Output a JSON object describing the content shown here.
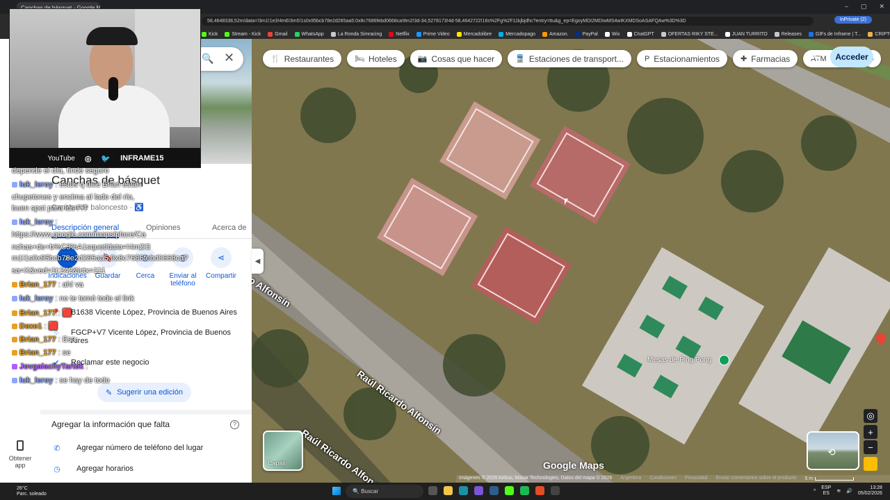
{
  "browser": {
    "tab_title": "Canchas de básquet - Google Maps",
    "url": "58,4648338,52m/data=!3m1!1e3!4m6!3m5!1s0x95bcb78e2d285aa5:0x8c7686febd0668ca!8m2!3d-34,5278173!4d-58,4642722!16s%2Fg%2F11kjbjdhc?entry=ttu&g_ep=EgoyMDI2MDIwMS4wIKXMDSoASAFQAw%3D%3D",
    "inprivate_label": "InPrivate (2)",
    "bookmarks": [
      {
        "label": "Kick",
        "color": "#53fc18"
      },
      {
        "label": "Stream - Kick",
        "color": "#53fc18"
      },
      {
        "label": "Gmail",
        "color": "#ea4335"
      },
      {
        "label": "WhatsApp",
        "color": "#25d366"
      },
      {
        "label": "La Ronda Simracing",
        "color": "#c8c8c8"
      },
      {
        "label": "Netflix",
        "color": "#e50914"
      },
      {
        "label": "Prime Video",
        "color": "#1a98ff"
      },
      {
        "label": "Mercadolibre",
        "color": "#ffe600"
      },
      {
        "label": "Mercadopago",
        "color": "#00b1ea"
      },
      {
        "label": "Amazon.",
        "color": "#ff9900"
      },
      {
        "label": "PayPal",
        "color": "#003087"
      },
      {
        "label": "Wix",
        "color": "#ffffff"
      },
      {
        "label": "ChatGPT",
        "color": "#ffffff"
      },
      {
        "label": "OFERTAS RIKY STE...",
        "color": "#c8c8c8"
      },
      {
        "label": "JUAN TURRITO",
        "color": "#ffffff"
      },
      {
        "label": "Releases",
        "color": "#c8c8c8"
      },
      {
        "label": "GIFs de Inframe | T...",
        "color": "#1a73e8"
      },
      {
        "label": "CRIPTO",
        "color": "#e8b44c"
      },
      {
        "label": "aires",
        "color": "#e8b44c"
      }
    ]
  },
  "map": {
    "chips": [
      {
        "icon": "restaurant-icon",
        "glyph": "🍴",
        "label": "Restaurantes"
      },
      {
        "icon": "hotel-icon",
        "glyph": "🛏",
        "label": "Hoteles"
      },
      {
        "icon": "camera-icon",
        "glyph": "📷",
        "label": "Cosas que hacer"
      },
      {
        "icon": "train-icon",
        "glyph": "🚆",
        "label": "Estaciones de transport..."
      },
      {
        "icon": "parking-icon",
        "glyph": "P",
        "label": "Estacionamientos"
      },
      {
        "icon": "pharmacy-icon",
        "glyph": "✚",
        "label": "Farmacias"
      },
      {
        "icon": "atm-icon",
        "glyph": "ATM",
        "label": "Cajer"
      }
    ],
    "signin": "Acceder",
    "streets": [
      "Raúl Ricardo Alfonsín",
      "Raúl Ricardo Alfonsín",
      "o Alfonsín"
    ],
    "poi": "Mesas de Ping Pong",
    "logo": "Google Maps",
    "attribution": "Imágenes © 2026 Airbus, Maxar Technologies, Datos del mapa © 2026",
    "footer_links": [
      "Argentina",
      "Condiciones",
      "Privacidad",
      "Enviar comentarios sobre el producto"
    ],
    "scale": "5 m",
    "layers_label": "Capas"
  },
  "left_rail": {
    "get_app": "Obtener app"
  },
  "place": {
    "title": "Canchas de básquet",
    "category": "Cancha de baloncesto",
    "tabs": [
      "Descripción general",
      "Opiniones",
      "Acerca de"
    ],
    "actions": [
      {
        "icon": "directions-icon",
        "glyph": "➤",
        "label": "Indicaciones"
      },
      {
        "icon": "bookmark-icon",
        "glyph": "🔖",
        "label": "Guardar"
      },
      {
        "icon": "nearby-icon",
        "glyph": "◎",
        "label": "Cerca"
      },
      {
        "icon": "send-to-phone-icon",
        "glyph": "▯",
        "label": "Enviar al teléfono"
      },
      {
        "icon": "share-icon",
        "glyph": "⋖",
        "label": "Compartir"
      }
    ],
    "address": "B1638 Vicente López, Provincia de Buenos Aires",
    "plus_code": "FGCP+V7 Vicente López, Provincia de Buenos Aires",
    "claim": "Reclamar este negocio",
    "suggest_edit": "Sugerir una edición",
    "missing_title": "Agregar la información que falta",
    "add_phone": "Agregar número de teléfono del lugar",
    "add_hours": "Agregar horarios"
  },
  "webcam": {
    "youtube": "YouTube",
    "handle": "INFRAME15"
  },
  "chat": [
    {
      "user": "",
      "msg": "depende el día, finde seguro",
      "color": "#ffffff"
    },
    {
      "user": "luk_leroy",
      "msg": ": estos q dice Brian están",
      "color": "#8fa6ff"
    },
    {
      "user": "",
      "msg": "chupetones y encima al lado del río,",
      "color": "#ffffff"
    },
    {
      "user": "",
      "msg": "buen spot para los P.T",
      "color": "#ffffff"
    },
    {
      "user": "luk_leroy",
      "msg": ":",
      "color": "#8fa6ff"
    },
    {
      "user": "",
      "msg": "https://www.google.com/maps/place/Ca",
      "color": "#ffffff"
    },
    {
      "user": "",
      "msg": "nchas+de+b%C3%A1squet/data=!4m2!3",
      "color": "#ffffff"
    },
    {
      "user": "",
      "msg": "m1!1s0x95bcb78e2d285aa5:0x8c7686febd0668ca?",
      "color": "#ffffff"
    },
    {
      "user": "",
      "msg": "sa=X&ved=1t:242&ictx=111",
      "color": "#ffffff"
    },
    {
      "user": "Brian_177",
      "msg": ": ahí va",
      "color": "#e8a020"
    },
    {
      "user": "luk_leroy",
      "msg": ": no te tomó todo el link",
      "color": "#8fa6ff"
    },
    {
      "user": "Brian_177",
      "msg": ": 🟥",
      "color": "#e8a020"
    },
    {
      "user": "Dexe1",
      "msg": ": 🟥",
      "color": "#e8a020"
    },
    {
      "user": "Brian_177",
      "msg": ": Esa",
      "color": "#e8a020"
    },
    {
      "user": "Brian_177",
      "msg": ": se",
      "color": "#e8a020"
    },
    {
      "user": "JovgalachyTartek",
      "msg": ":",
      "color": "#b05cff"
    },
    {
      "user": "luk_leroy",
      "msg": ": se hay de todo",
      "color": "#8fa6ff"
    }
  ],
  "taskbar": {
    "temp": "26°C",
    "weather": "Parc. soleado",
    "search": "Buscar",
    "lang": "ESP",
    "lang2": "ES",
    "time": "13:28",
    "date": "05/02/2026"
  }
}
